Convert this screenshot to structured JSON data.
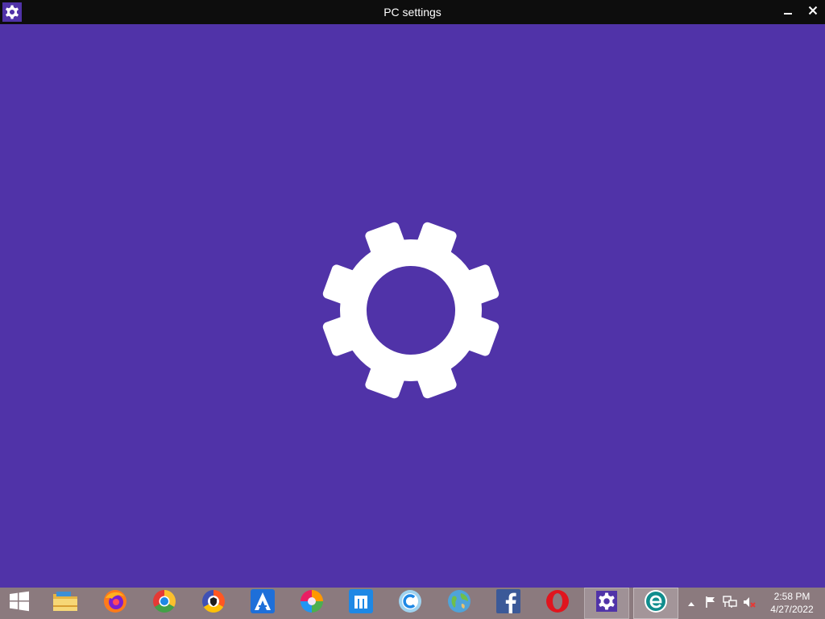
{
  "window": {
    "title": "PC settings",
    "icon": "gear-icon",
    "buttons": [
      "minimize-icon",
      "close-icon"
    ]
  },
  "main": {
    "background_color": "#5033a8",
    "splash_icon": "gear-icon"
  },
  "taskbar": {
    "items": [
      {
        "name": "start-button",
        "icon": "windows-logo-icon"
      },
      {
        "name": "file-explorer",
        "icon": "folder-icon"
      },
      {
        "name": "firefox",
        "icon": "firefox-icon"
      },
      {
        "name": "chrome",
        "icon": "chrome-icon"
      },
      {
        "name": "browser-shield",
        "icon": "shield-browser-icon"
      },
      {
        "name": "browser-a",
        "icon": "a-browser-icon"
      },
      {
        "name": "browser-swirl",
        "icon": "swirl-browser-icon"
      },
      {
        "name": "maxthon",
        "icon": "maxthon-icon"
      },
      {
        "name": "cent-browser",
        "icon": "c-browser-icon"
      },
      {
        "name": "globe-browser",
        "icon": "globe-icon"
      },
      {
        "name": "facebook",
        "icon": "facebook-icon"
      },
      {
        "name": "opera",
        "icon": "opera-icon"
      },
      {
        "name": "pc-settings",
        "icon": "gear-icon",
        "state": "active"
      },
      {
        "name": "eset",
        "icon": "eset-icon",
        "state": "running"
      }
    ],
    "tray": {
      "icons": [
        "show-hidden-icons",
        "flag-icon",
        "network-icon",
        "volume-muted-icon"
      ],
      "time": "2:58 PM",
      "date": "4/27/2022"
    }
  }
}
